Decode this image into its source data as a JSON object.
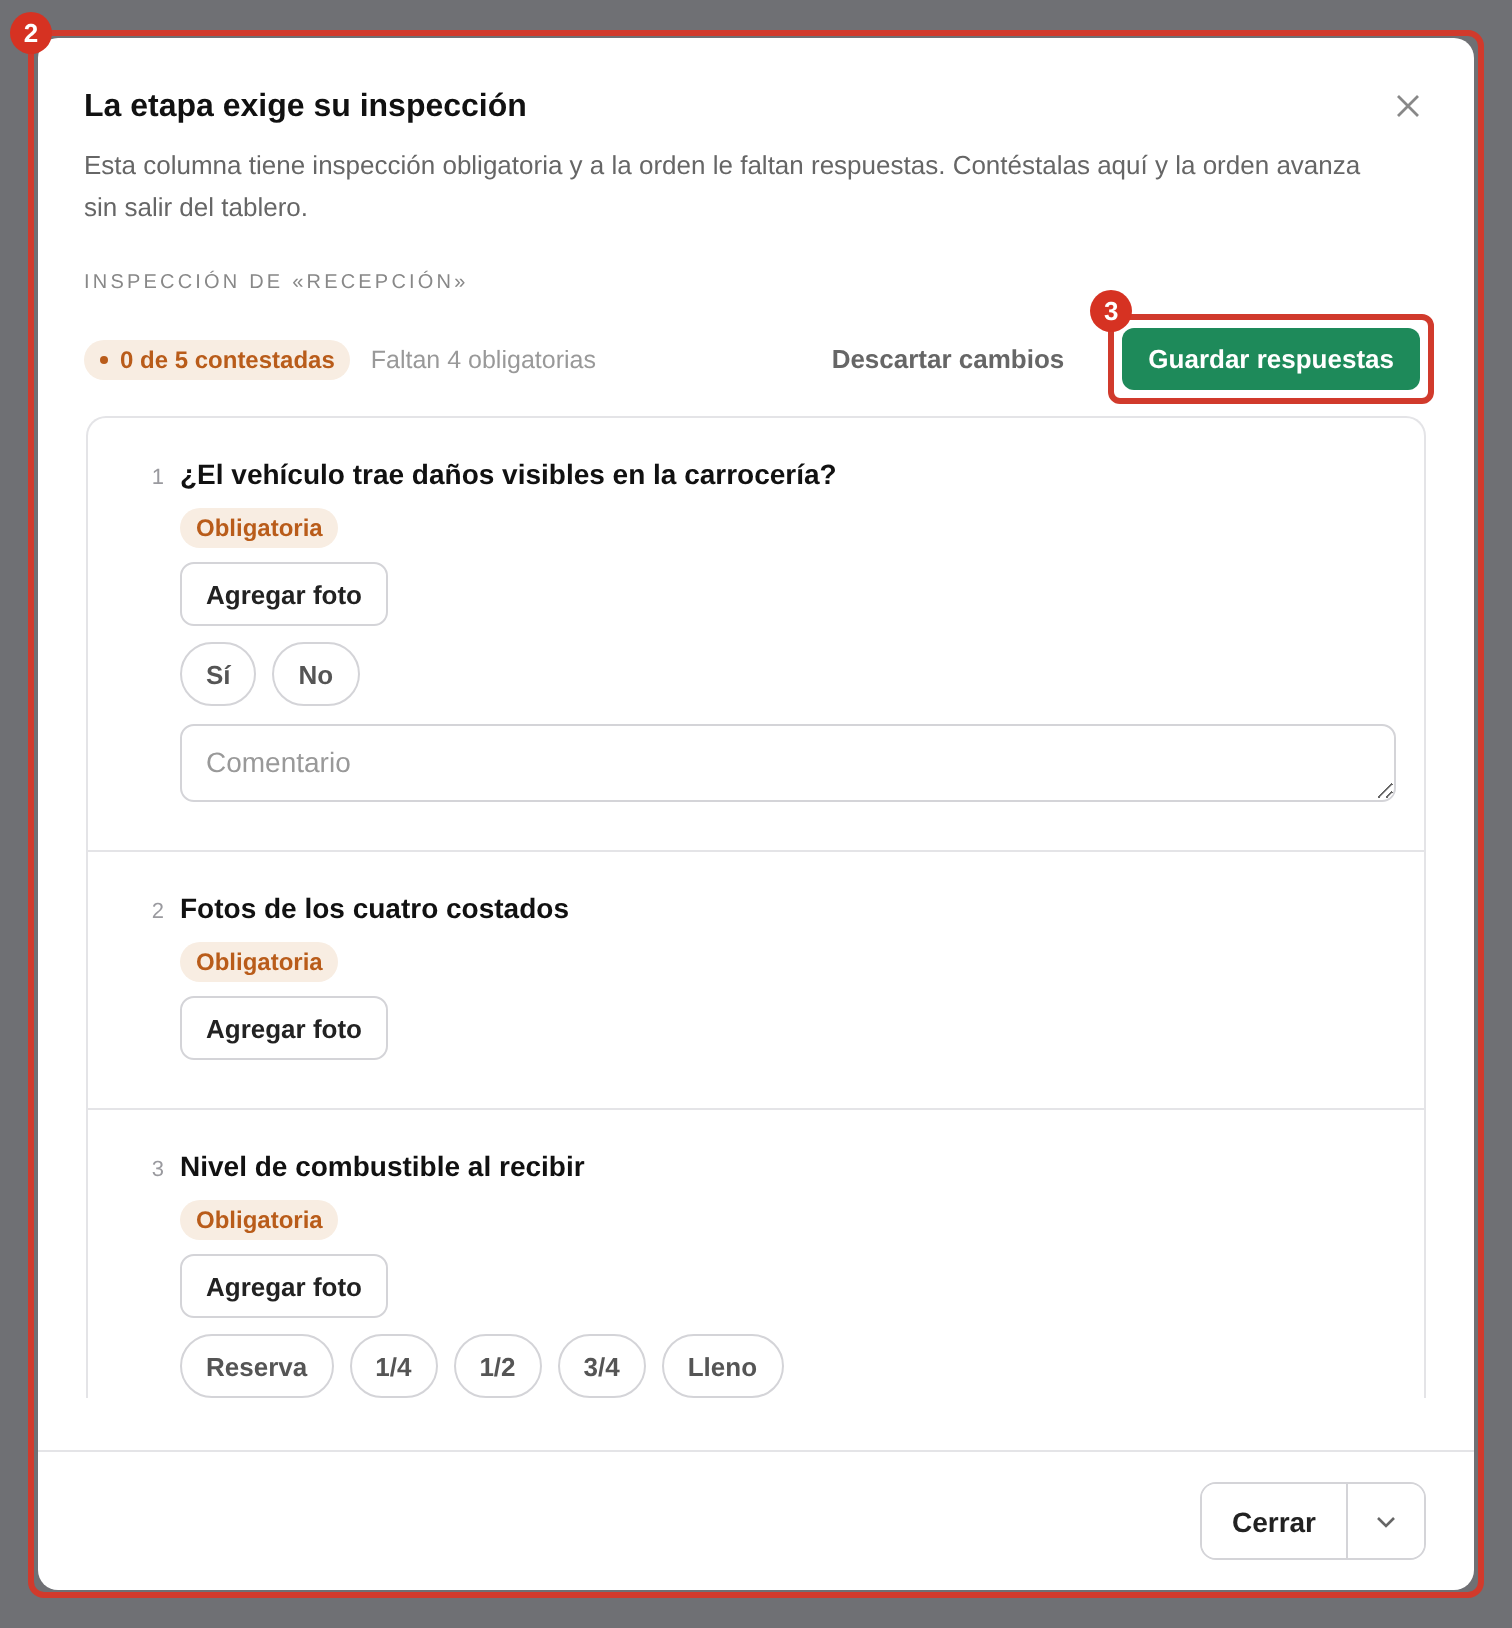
{
  "annotations": [
    {
      "label": "2"
    },
    {
      "label": "3"
    }
  ],
  "dialog": {
    "title": "La etapa exige su inspección",
    "description": "Esta columna tiene inspección obligatoria y a la orden le faltan respuestas. Contéstalas aquí y la orden avanza sin salir del tablero.",
    "section_label": "INSPECCIÓN DE «RECEPCIÓN»",
    "progress": "0 de 5 contestadas",
    "missing": "Faltan 4 obligatorias",
    "discard_button": "Descartar cambios",
    "save_button": "Guardar respuestas",
    "questions": [
      {
        "number": "1",
        "text": "¿El vehículo trae daños visibles en la carrocería?",
        "badge": "Obligatoria",
        "photo_button": "Agregar foto",
        "options": [
          {
            "label": "Sí",
            "selected": false
          },
          {
            "label": "No",
            "selected": false
          }
        ],
        "comment": {
          "placeholder": "Comentario"
        }
      },
      {
        "number": "2",
        "text": "Fotos de los cuatro costados",
        "badge": "Obligatoria",
        "photo_button": "Agregar foto"
      },
      {
        "number": "3",
        "text": "Nivel de combustible al recibir",
        "badge": "Obligatoria",
        "photo_button": "Agregar foto",
        "options": [
          {
            "label": "Reserva",
            "selected": false
          },
          {
            "label": "1/4",
            "selected": false
          },
          {
            "label": "1/2",
            "selected": false
          },
          {
            "label": "3/4",
            "selected": false
          },
          {
            "label": "Lleno",
            "selected": false
          }
        ]
      }
    ],
    "close_button": "Cerrar"
  }
}
